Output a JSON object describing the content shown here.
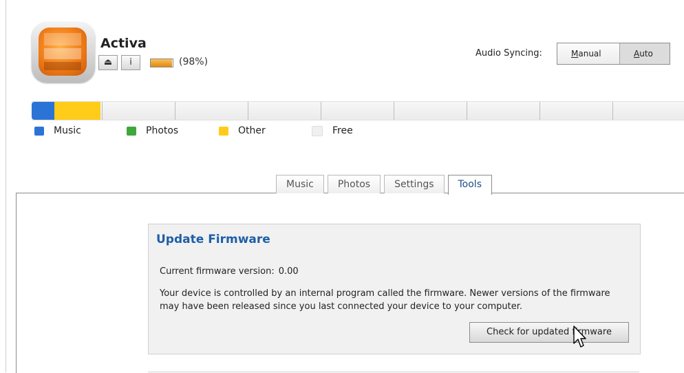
{
  "device": {
    "name": "Activa",
    "battery_label": "(98%)",
    "battery_level": 0.98,
    "eject_icon": "eject-icon",
    "info_label": "i"
  },
  "sync": {
    "label": "Audio Syncing:",
    "options": [
      {
        "key": "M",
        "rest": "anual"
      },
      {
        "key": "A",
        "rest": "uto"
      }
    ],
    "selected": "Auto"
  },
  "storage": {
    "segments": [
      {
        "name": "Music",
        "fraction": 0.035,
        "color": "#2b74d6"
      },
      {
        "name": "Other",
        "fraction": 0.07,
        "color": "#ffcc19"
      },
      {
        "name": "Free",
        "fraction": 0.895,
        "color": "#f0f0f0"
      }
    ],
    "legend": [
      "Music",
      "Photos",
      "Other",
      "Free"
    ],
    "legend_colors": [
      "#2b74d6",
      "#3ea83a",
      "#ffcc19",
      "#f0f0f0"
    ]
  },
  "tabs": [
    "Music",
    "Photos",
    "Settings",
    "Tools"
  ],
  "active_tab": "Tools",
  "firmware": {
    "title": "Update Firmware",
    "version_label": "Current firmware version:",
    "version_value": "0.00",
    "description": "Your device is controlled by an internal program called the firmware. Newer versions of the firmware may have been released since you last connected your device to your computer.",
    "check_button": "Check for updated firmware"
  }
}
